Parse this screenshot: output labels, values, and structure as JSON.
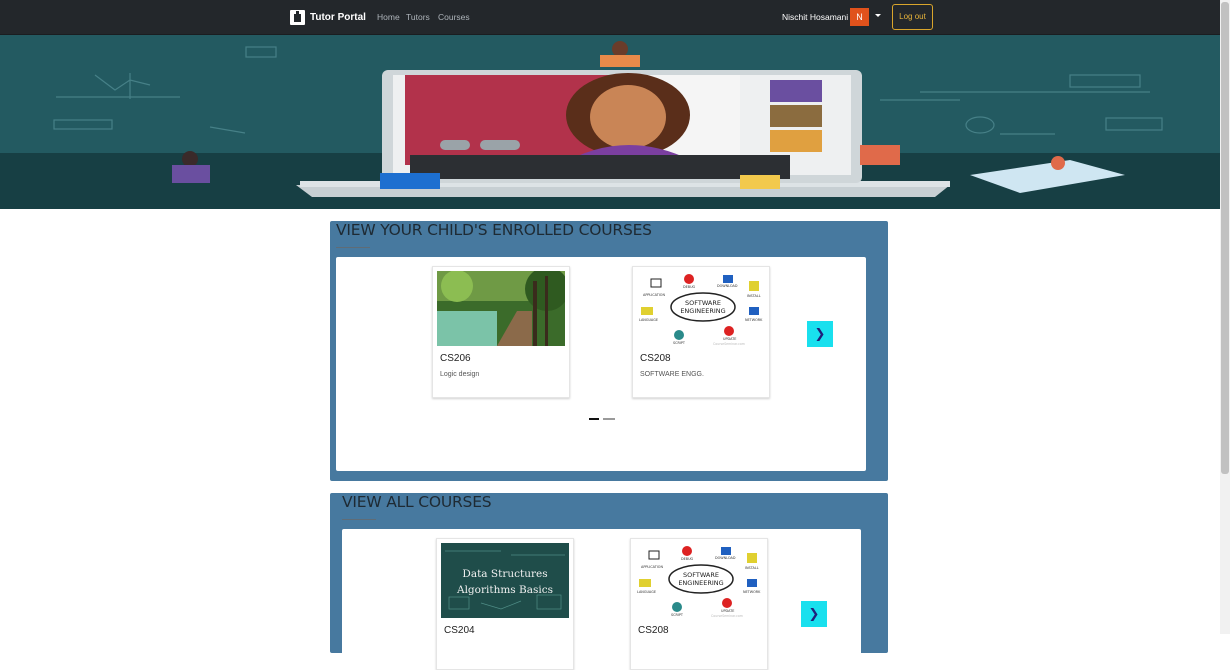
{
  "navbar": {
    "brand": "Tutor Portal",
    "links": [
      "Home",
      "Tutors",
      "Courses"
    ],
    "user_name": "Nischit Hosamani",
    "avatar_initial": "N",
    "logout_label": "Log out"
  },
  "enrolled": {
    "title": "VIEW YOUR CHILD'S ENROLLED COURSES",
    "cards": [
      {
        "code": "CS206",
        "desc": "Logic design"
      },
      {
        "code": "CS208",
        "desc": "SOFTWARE ENGG."
      }
    ],
    "next_label": "❯"
  },
  "all": {
    "title": "VIEW ALL COURSES",
    "cards": [
      {
        "code": "CS204",
        "image_text": [
          "Data Structures",
          "Algorithms Basics"
        ]
      },
      {
        "code": "CS208"
      }
    ],
    "next_label": "❯"
  },
  "software_graphic": {
    "title": [
      "SOFTWARE",
      "ENGINEERING"
    ],
    "labels": [
      "APPLICATION",
      "DEBUG",
      "DOWNLOAD",
      "INSTALL",
      "NETWORK",
      "LANGUAGE",
      "SCRIPT",
      "UPDATE"
    ],
    "watermark": "CourseSeminar.com"
  },
  "colors": {
    "navbar": "#23272b",
    "section_bg": "#47799f",
    "accent_button": "#19e0ee",
    "logout_border": "#d9a52c",
    "avatar": "#e0521c"
  }
}
